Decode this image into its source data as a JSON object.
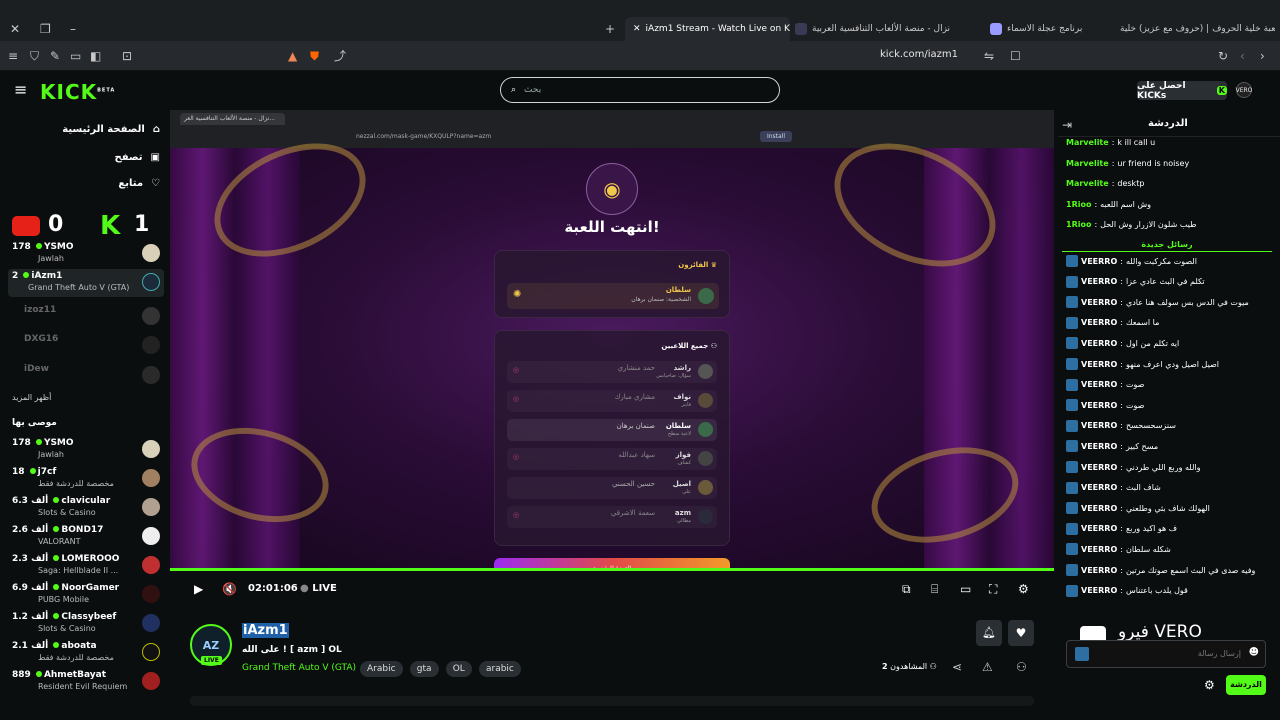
{
  "browser": {
    "tabs": [
      {
        "label": "لعبة خلية الحروف | (حروف مع عزيز) خلية",
        "active": false
      },
      {
        "label": "برنامج عجلة الاسماء",
        "active": false
      },
      {
        "label": "نزال - منصة الألعاب التنافسية العربية",
        "active": false
      },
      {
        "label": "iAzm1 Stream - Watch Live on K",
        "active": true
      }
    ],
    "url": "kick.com/iazm1"
  },
  "header": {
    "logo": "KICK",
    "logo_sup": "BETA",
    "search_placeholder": "بحث",
    "get_kicks": "احصل على KICKs"
  },
  "sidebar": {
    "nav": [
      {
        "label": "الصفحة الرئيسية",
        "icon": "home-icon"
      },
      {
        "label": "تصفح",
        "icon": "browse-icon"
      },
      {
        "label": "متابع",
        "icon": "heart-icon"
      }
    ],
    "score": {
      "left": "0",
      "right": "1"
    },
    "following": [
      {
        "viewers": "178",
        "name": "YSMO",
        "category": "Jawlah",
        "live": true
      },
      {
        "viewers": "2",
        "name": "iAzm1",
        "category": "Grand Theft Auto V (GTA)",
        "live": true
      },
      {
        "viewers": "",
        "name": "izoz11",
        "category": "",
        "live": false
      },
      {
        "viewers": "",
        "name": "DXG16",
        "category": "",
        "live": false
      },
      {
        "viewers": "",
        "name": "iDew",
        "category": "",
        "live": false
      }
    ],
    "show_more": "أظهر المزيد",
    "recommended_title": "موصى بها",
    "recommended": [
      {
        "viewers": "178",
        "name": "YSMO",
        "category": "Jawlah"
      },
      {
        "viewers": "18",
        "name": "j7cf",
        "category": "مخصصة للدردشة فقط"
      },
      {
        "viewers": "6.3 ألف",
        "name": "clavicular",
        "category": "Slots & Casino"
      },
      {
        "viewers": "2.6 ألف",
        "name": "BOND17",
        "category": "VALORANT"
      },
      {
        "viewers": "2.3 ألف",
        "name": "LOMEROOO",
        "category": "Saga: Hellblade II ..."
      },
      {
        "viewers": "6.9 ألف",
        "name": "NoorGamer",
        "category": "PUBG Mobile"
      },
      {
        "viewers": "1.2 ألف",
        "name": "Classybeef",
        "category": "Slots & Casino"
      },
      {
        "viewers": "2.1 ألف",
        "name": "aboata",
        "category": "مخصصة للدردشة فقط"
      },
      {
        "viewers": "889",
        "name": "AhmetBayat",
        "category": "Resident Evil Requiem"
      }
    ]
  },
  "player": {
    "inner_tab": "نزال - منصة الألعاب التنافسية العر...",
    "inner_url": "nezzal.com/mask-game/KXQULP?name=azm",
    "install": "Install",
    "game_over": "انتهت اللعبة!",
    "winners_title": "الفائزون",
    "winner_name": "سلطان",
    "winner_sub": "الشخصية: صنمان برهان",
    "all_players_title": "جميع اللاعبين",
    "players": [
      {
        "name": "راشد",
        "sub": "سؤال: صاحيانس",
        "target": "حمد منشاري"
      },
      {
        "name": "نواف",
        "sub": "فايتر",
        "target": "مشاري مبارك"
      },
      {
        "name": "سلطان",
        "sub": "لاعبة سطح",
        "target": "صنمان برهان"
      },
      {
        "name": "فواز",
        "sub": "كشاف",
        "target": "سهاد عبدالله"
      },
      {
        "name": "اصيل",
        "sub": "علي",
        "target": "حسين الحسني"
      },
      {
        "name": "azm",
        "sub": "مظالي",
        "target": "سعمة الاشرقي"
      }
    ],
    "bottom_button": "العودة للرئيسية",
    "time": "02:01:06",
    "live_label": "LIVE"
  },
  "stream": {
    "channel": "iAzm1",
    "live_badge": "LIVE",
    "title": "على الله ! [ azm ] OL",
    "category": "Grand Theft Auto V (GTA)",
    "tags": [
      "Arabic",
      "gta",
      "OL",
      "arabic"
    ],
    "viewers_label": "المشاهدون",
    "viewers": "2"
  },
  "chat": {
    "title": "الدردشة",
    "new_messages": "رسائل جديدة",
    "messages": [
      {
        "user": "Marvelite",
        "text": "k ill call u",
        "badge": false
      },
      {
        "user": "Marvelite",
        "text": "ur friend is noisey",
        "badge": false
      },
      {
        "user": "Marvelite",
        "text": "desktp",
        "badge": false
      },
      {
        "user": "1Rioo",
        "text": "وش اسم اللعبه",
        "badge": false
      },
      {
        "user": "1Rioo",
        "text": "طيب شلون الازرار وش الحل",
        "badge": false
      },
      {
        "user": "VEERRO",
        "text": "الصوت مكركبت والله",
        "badge": true
      },
      {
        "user": "VEERRO",
        "text": "تكلم في البث عادي عزا",
        "badge": true
      },
      {
        "user": "VEERRO",
        "text": "ميوت في الدس بس سولف هنا عادي",
        "badge": true
      },
      {
        "user": "VEERRO",
        "text": "ما اسمعك",
        "badge": true
      },
      {
        "user": "VEERRO",
        "text": "ايه تكلم من اول",
        "badge": true
      },
      {
        "user": "VEERRO",
        "text": "اصيل اصيل ودي اعرف منهو",
        "badge": true
      },
      {
        "user": "VEERRO",
        "text": "صوت",
        "badge": true
      },
      {
        "user": "VEERRO",
        "text": "صوت",
        "badge": true
      },
      {
        "user": "VEERRO",
        "text": "سنزسحسحسح",
        "badge": true
      },
      {
        "user": "VEERRO",
        "text": "مسح كبير",
        "badge": true
      },
      {
        "user": "VEERRO",
        "text": "والله وربع اللي طردني",
        "badge": true
      },
      {
        "user": "VEERRO",
        "text": "شاف البث",
        "badge": true
      },
      {
        "user": "VEERRO",
        "text": "الهولك شاف بثي وطلعني",
        "badge": true
      },
      {
        "user": "VEERRO",
        "text": "ف هو اكيد وربع",
        "badge": true
      },
      {
        "user": "VEERRO",
        "text": "شكله سلطان",
        "badge": true
      },
      {
        "user": "VEERRO",
        "text": "وفيه صدى في البث اسمع صوتك مرتين",
        "badge": true
      },
      {
        "user": "VEERRO",
        "text": "قول يلدب باعتناس",
        "badge": true
      }
    ],
    "input_placeholder": "إرسال رسالة",
    "send_button": "الدردشة",
    "overlay_text": "فيرو VERO"
  },
  "colors": {
    "kick_green": "#53fc18",
    "bg": "#0b0e0f",
    "panel": "#2a2f33",
    "badge": "#2d6fa3"
  }
}
